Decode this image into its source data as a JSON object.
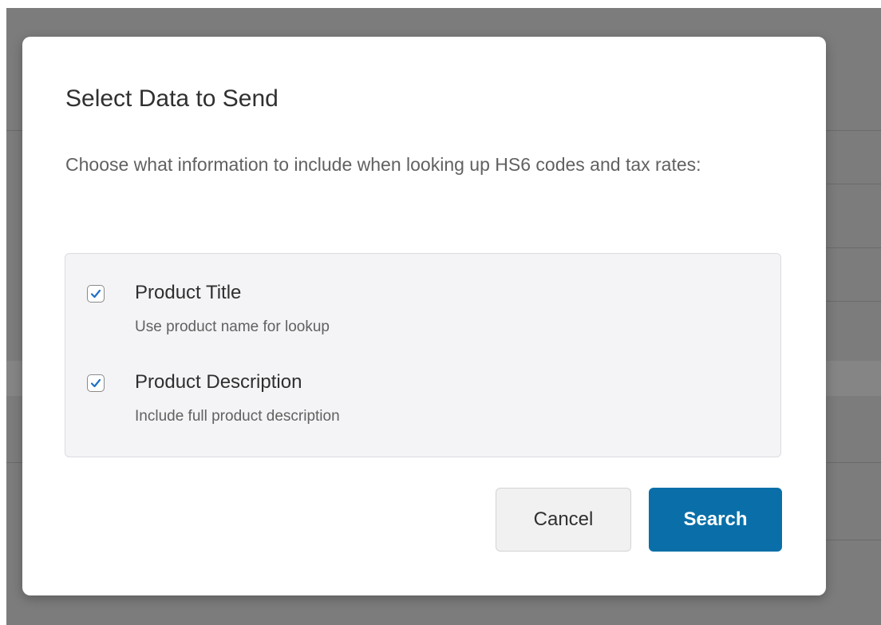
{
  "colors": {
    "accent": "#0a6fa8",
    "checkmark": "#1f6fc5",
    "overlay": "#7c7c7c",
    "options_background": "#f4f4f7"
  },
  "modal": {
    "title": "Select Data to Send",
    "description": "Choose what information to include when looking up HS6 codes and tax rates:",
    "options": [
      {
        "label": "Product Title",
        "help": "Use product name for lookup",
        "checked": true,
        "icon": "checkmark-icon"
      },
      {
        "label": "Product Description",
        "help": "Include full product description",
        "checked": true,
        "icon": "checkmark-icon"
      }
    ],
    "buttons": {
      "cancel": "Cancel",
      "search": "Search"
    }
  }
}
